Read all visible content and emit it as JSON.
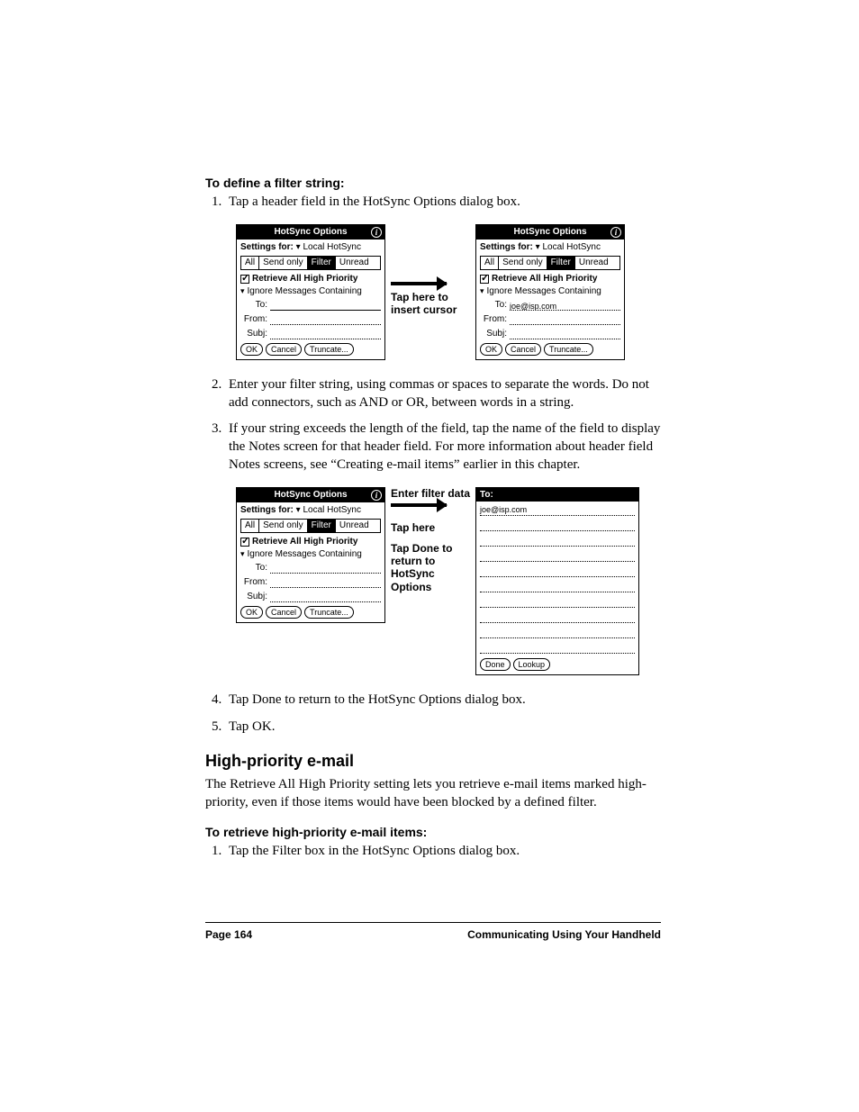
{
  "headings": {
    "define_filter": "To define a filter string:",
    "high_priority": "High-priority e-mail",
    "retrieve_high": "To retrieve high-priority e-mail items:"
  },
  "steps": {
    "define": [
      "Tap a header field in the HotSync Options dialog box.",
      "Enter your filter string, using commas or spaces to separate the words. Do not add connectors, such as AND or OR, between words in a string.",
      "If your string exceeds the length of the field, tap the name of the field to display the Notes screen for that header field. For more information about header field Notes screens, see “Creating e-mail items” earlier in this chapter.",
      "Tap Done to return to the HotSync Options dialog box.",
      "Tap OK."
    ],
    "retrieve": [
      "Tap the Filter box in the HotSync Options dialog box."
    ]
  },
  "body": {
    "high_priority_para": "The Retrieve All High Priority setting lets you retrieve e-mail items marked high-priority, even if those items would have been blocked by a defined filter."
  },
  "palm": {
    "title": "HotSync Options",
    "info_glyph": "i",
    "settings_for": "Settings for:",
    "settings_value": "Local HotSync",
    "tabs": [
      "All",
      "Send only",
      "Filter",
      "Unread"
    ],
    "selected_tab": "Filter",
    "retrieve_high": "Retrieve All High Priority",
    "ignore_label": "Ignore Messages Containing",
    "fields": {
      "to": "To:",
      "from": "From:",
      "subj": "Subj:"
    },
    "sample_to_value": "joe@isp.com",
    "buttons": {
      "ok": "OK",
      "cancel": "Cancel",
      "truncate": "Truncate..."
    }
  },
  "callouts": {
    "tap_here": "Tap here to insert cursor",
    "enter_filter": "Enter filter data",
    "tap_here2": "Tap here",
    "tap_done": "Tap Done to return to HotSync Options"
  },
  "notes": {
    "title": "To:",
    "value": "joe@isp.com",
    "done": "Done",
    "lookup": "Lookup"
  },
  "footer": {
    "page": "Page 164",
    "section": "Communicating Using Your Handheld"
  }
}
